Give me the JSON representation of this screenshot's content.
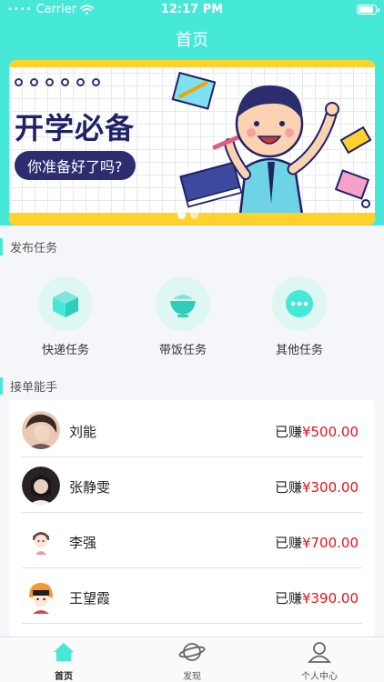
{
  "status": {
    "carrier": "Carrier",
    "time": "12:17 PM"
  },
  "nav": {
    "title": "首页"
  },
  "banner": {
    "title": "开学必备",
    "subtitle": "你准备好了吗?",
    "active_page": 1,
    "page_count": 2
  },
  "sections": {
    "publish": "发布任务",
    "helpers": "接单能手"
  },
  "tasks": [
    {
      "label": "快递任务",
      "icon": "package-icon"
    },
    {
      "label": "带饭任务",
      "icon": "bowl-icon"
    },
    {
      "label": "其他任务",
      "icon": "more-icon"
    }
  ],
  "earned_prefix": "已赚",
  "helpers": [
    {
      "name": "刘能",
      "amount": "¥500.00"
    },
    {
      "name": "张静雯",
      "amount": "¥300.00"
    },
    {
      "name": "李强",
      "amount": "¥700.00"
    },
    {
      "name": "王望霞",
      "amount": "¥390.00"
    }
  ],
  "tabbar": [
    {
      "label": "首页",
      "icon": "home-icon",
      "active": true
    },
    {
      "label": "发现",
      "icon": "planet-icon",
      "active": false
    },
    {
      "label": "个人中心",
      "icon": "person-icon",
      "active": false
    }
  ],
  "colors": {
    "accent": "#46e8d7",
    "money": "#e0141c",
    "banner_yellow": "#ffd12c",
    "banner_navy": "#1f2366"
  }
}
